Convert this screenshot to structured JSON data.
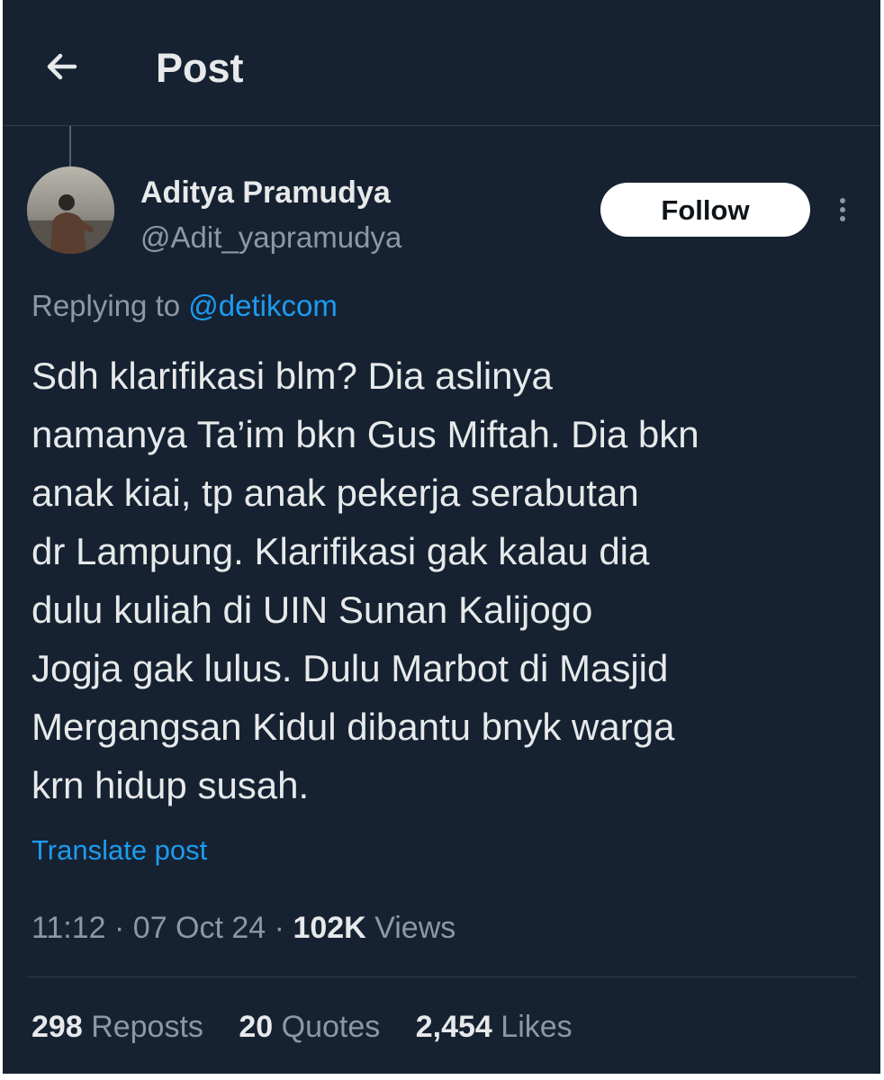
{
  "header": {
    "title": "Post",
    "back_icon": "arrow-left-icon"
  },
  "author": {
    "display_name": "Aditya Pramudya",
    "handle": "@Adit_yapramudya",
    "follow_label": "Follow",
    "more_icon": "more-vertical-icon"
  },
  "reply": {
    "prefix": "Replying to ",
    "mention": "@detikcom"
  },
  "tweet": {
    "lines": [
      "Sdh klarifikasi blm? Dia aslinya",
      "namanya Ta’im bkn Gus Miftah. Dia bkn",
      "anak kiai, tp anak pekerja serabutan",
      "dr Lampung. Klarifikasi gak kalau dia",
      "dulu kuliah di UIN Sunan Kalijogo",
      "Jogja gak lulus. Dulu Marbot di Masjid",
      "Mergangsan Kidul dibantu bnyk warga",
      "krn hidup susah."
    ],
    "translate_label": "Translate post"
  },
  "meta": {
    "time": "11:12",
    "separator": "·",
    "date": "07 Oct 24",
    "views_count": "102K",
    "views_label": "Views"
  },
  "stats": {
    "reposts_count": "298",
    "reposts_label": "Reposts",
    "quotes_count": "20",
    "quotes_label": "Quotes",
    "likes_count": "2,454",
    "likes_label": "Likes"
  },
  "colors": {
    "background": "#162231",
    "text_primary": "#e7e9ea",
    "text_secondary": "#8b98a5",
    "link": "#1d9bf0",
    "follow_bg": "#ffffff"
  }
}
